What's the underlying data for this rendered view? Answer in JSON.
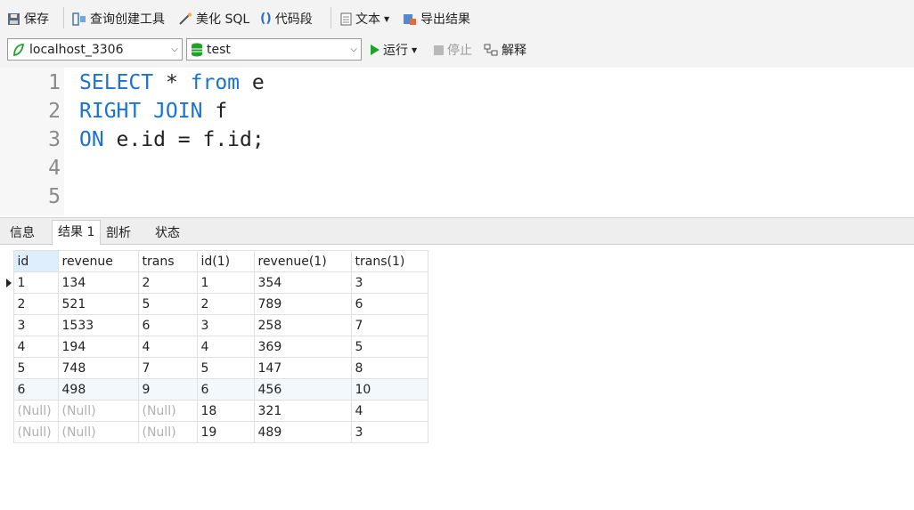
{
  "toolbar": {
    "save": "保存",
    "query_builder": "查询创建工具",
    "beautify": "美化 SQL",
    "snippet": "代码段",
    "text": "文本",
    "export": "导出结果"
  },
  "toolbar2": {
    "connection": "localhost_3306",
    "database": "test",
    "run": "运行",
    "stop": "停止",
    "explain": "解释"
  },
  "editor": {
    "line_numbers": [
      "1",
      "2",
      "3",
      "4",
      "5"
    ],
    "lines": [
      {
        "kw1": "SELECT",
        "rest1": " * ",
        "kw2": "from",
        "rest2": " e"
      },
      {
        "kw1": "RIGHT JOIN",
        "rest1": " f",
        "kw2": "",
        "rest2": ""
      },
      {
        "kw1": "ON",
        "rest1": " e.id = f.id;",
        "kw2": "",
        "rest2": ""
      }
    ]
  },
  "tabs": [
    "信息",
    "结果 1",
    "剖析",
    "状态"
  ],
  "results": {
    "columns": [
      "id",
      "revenue",
      "trans",
      "id(1)",
      "revenue(1)",
      "trans(1)"
    ],
    "rows": [
      [
        "1",
        "134",
        "2",
        "1",
        "354",
        "3"
      ],
      [
        "2",
        "521",
        "5",
        "2",
        "789",
        "6"
      ],
      [
        "3",
        "1533",
        "6",
        "3",
        "258",
        "7"
      ],
      [
        "4",
        "194",
        "4",
        "4",
        "369",
        "5"
      ],
      [
        "5",
        "748",
        "7",
        "5",
        "147",
        "8"
      ],
      [
        "6",
        "498",
        "9",
        "6",
        "456",
        "10"
      ],
      [
        "(Null)",
        "(Null)",
        "(Null)",
        "18",
        "321",
        "4"
      ],
      [
        "(Null)",
        "(Null)",
        "(Null)",
        "19",
        "489",
        "3"
      ]
    ]
  },
  "colors": {
    "keyword": "#1a73d1",
    "null_text": "#b0b0b0",
    "run_green": "#22a02a"
  }
}
